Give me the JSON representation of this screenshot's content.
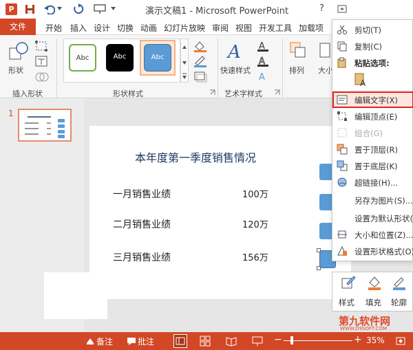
{
  "window": {
    "title": "演示文稿1 - Microsoft PowerPoint",
    "help_glyph": "?",
    "app_icon_letter": "P"
  },
  "colors": {
    "brand": "#d24726",
    "accent_blue": "#5b9bd5",
    "highlight_red": "#e02020"
  },
  "tabs": [
    "文件",
    "开始",
    "插入",
    "设计",
    "切换",
    "动画",
    "幻灯片放映",
    "审阅",
    "视图",
    "开发工具",
    "加载项"
  ],
  "ribbon": {
    "insert_shapes": {
      "shape_label": "形状",
      "group_label": "插入形状"
    },
    "shape_styles": {
      "samples": [
        "Abc",
        "Abc",
        "Abc"
      ],
      "group_label": "形状样式"
    },
    "art_styles": {
      "quick_styles_label": "快速样式",
      "group_label": "艺术字样式"
    },
    "arrange_label": "排列",
    "size_label": "大小"
  },
  "thumbnail": {
    "number": "1"
  },
  "slide": {
    "title": "本年度第一季度销售情况",
    "rows": [
      {
        "label": "一月销售业绩",
        "value": "100万"
      },
      {
        "label": "二月销售业绩",
        "value": "120万"
      },
      {
        "label": "三月销售业绩",
        "value": "156万"
      }
    ]
  },
  "context_menu": {
    "items": [
      {
        "label": "剪切(T)",
        "icon": "scissors-icon",
        "disabled": false
      },
      {
        "label": "复制(C)",
        "icon": "copy-icon",
        "disabled": false
      },
      {
        "label": "粘贴选项:",
        "icon": "paste-icon",
        "disabled": false
      },
      {
        "label": "编辑文字(X)",
        "icon": "edit-text-icon",
        "disabled": false,
        "highlighted": true
      },
      {
        "label": "编辑顶点(E)",
        "icon": "edit-points-icon",
        "disabled": false
      },
      {
        "label": "组合(G)",
        "icon": "group-icon",
        "disabled": true
      },
      {
        "label": "置于顶层(R)",
        "icon": "bring-front-icon",
        "disabled": false
      },
      {
        "label": "置于底层(K)",
        "icon": "send-back-icon",
        "disabled": false
      },
      {
        "label": "超链接(H)...",
        "icon": "hyperlink-icon",
        "disabled": false
      },
      {
        "label": "另存为图片(S)...",
        "icon": "",
        "disabled": false
      },
      {
        "label": "设置为默认形状(D)",
        "icon": "",
        "disabled": false
      },
      {
        "label": "大小和位置(Z)...",
        "icon": "size-position-icon",
        "disabled": false
      },
      {
        "label": "设置形状格式(O)...",
        "icon": "format-shape-icon",
        "disabled": false
      }
    ]
  },
  "mini_toolbar": {
    "style_label": "样式",
    "fill_label": "填充",
    "outline_label": "轮廓"
  },
  "watermark": {
    "main": "第九软件网",
    "sub": "WWW.D9SOFT.COM"
  },
  "statusbar": {
    "notes_label": "备注",
    "comments_label": "批注",
    "zoom_level": "35%"
  }
}
